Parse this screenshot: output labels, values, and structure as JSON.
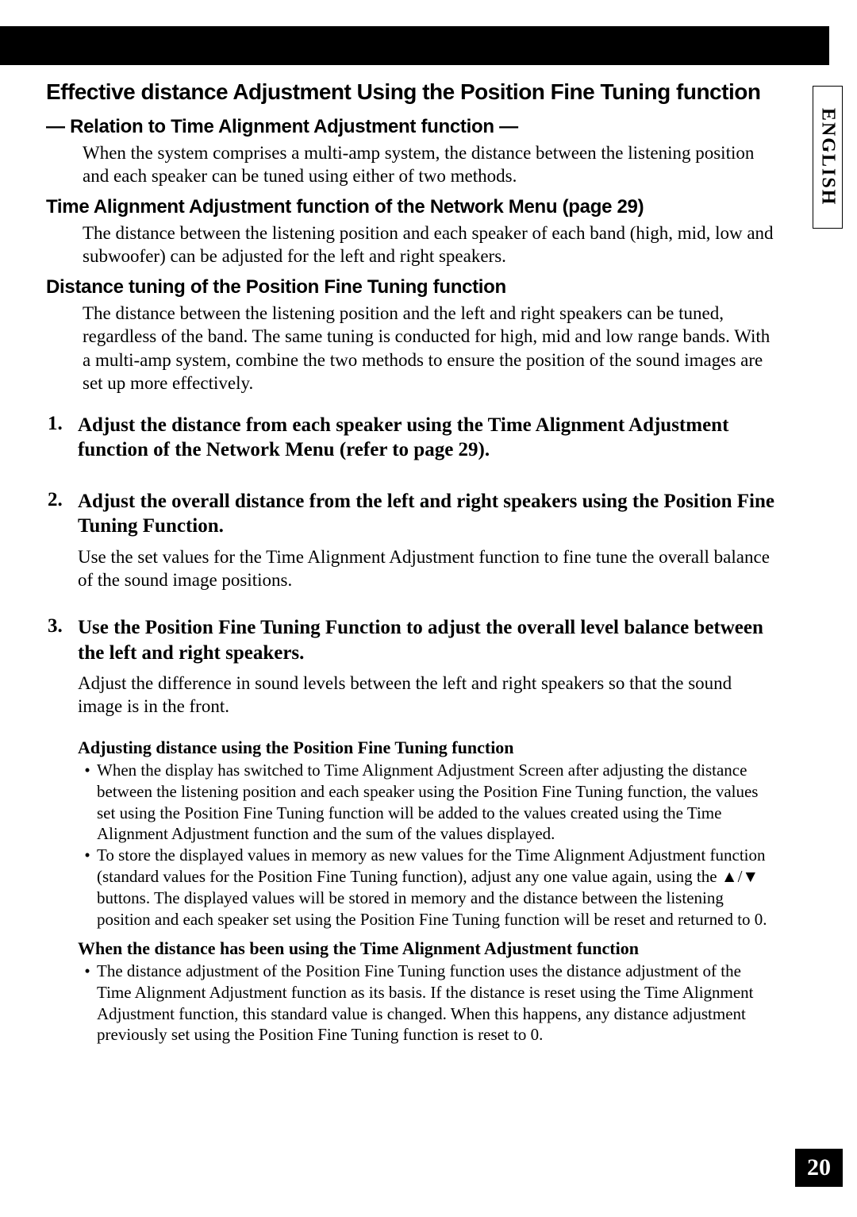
{
  "lang_tab": "ENGLISH",
  "page_number": "20",
  "title": "Effective distance Adjustment Using the Position Fine Tuning function",
  "sections": [
    {
      "heading": "— Relation to Time Alignment Adjustment function —",
      "body": "When the system comprises a multi-amp system, the distance between the listening position and each speaker can be tuned using either of two methods."
    },
    {
      "heading": "Time Alignment Adjustment function of the Network Menu (page 29)",
      "body": "The distance between the listening position and each speaker of each band (high, mid, low and subwoofer) can be adjusted for the left and right speakers."
    },
    {
      "heading": "Distance tuning of the Position Fine Tuning function",
      "body": "The distance between the listening position and the left and right speakers can be tuned, regardless of the band. The same tuning is conducted for high, mid and low range bands. With a multi-amp system, combine the two methods to ensure the position of the sound images are set up more effectively."
    }
  ],
  "steps": [
    {
      "num": "1.",
      "title": "Adjust the distance from each speaker using the Time Alignment Adjustment function of the Network Menu (refer to page 29).",
      "body": ""
    },
    {
      "num": "2.",
      "title": "Adjust the overall distance from the left and right speakers using the Position Fine Tuning Function.",
      "body": "Use the set values for the Time Alignment Adjustment function to fine tune the overall balance of the sound image positions."
    },
    {
      "num": "3.",
      "title": "Use the Position Fine Tuning Function to adjust the overall level balance between the left and right speakers.",
      "body": "Adjust the difference in sound levels between the left and right speakers so that the sound image is in the front."
    }
  ],
  "notes": [
    {
      "heading": "Adjusting distance using the Position Fine Tuning function",
      "bullets": [
        "When the display has switched to Time Alignment Adjustment Screen after adjusting the distance between the listening position and each speaker using the Position Fine Tuning function, the values set using the Position Fine Tuning function will be added to the values created using the Time Alignment Adjustment function and the sum of the values displayed.",
        "To store the displayed values in memory as new values for the Time Alignment Adjustment function (standard values for the Position Fine Tuning function), adjust any one value again, using the ▲/▼ buttons. The displayed values will be stored in memory and the distance between the listening position and each speaker set using the Position Fine Tuning function will be reset and returned to 0."
      ]
    },
    {
      "heading": "When the distance has been using the Time Alignment Adjustment function",
      "bullets": [
        "The distance adjustment of the Position Fine Tuning function uses the distance adjustment of the Time Alignment Adjustment function as its basis. If the distance is reset using the Time Alignment Adjustment function, this standard value is changed. When this happens, any distance adjustment previously set using the Position Fine Tuning function is reset to 0."
      ]
    }
  ]
}
